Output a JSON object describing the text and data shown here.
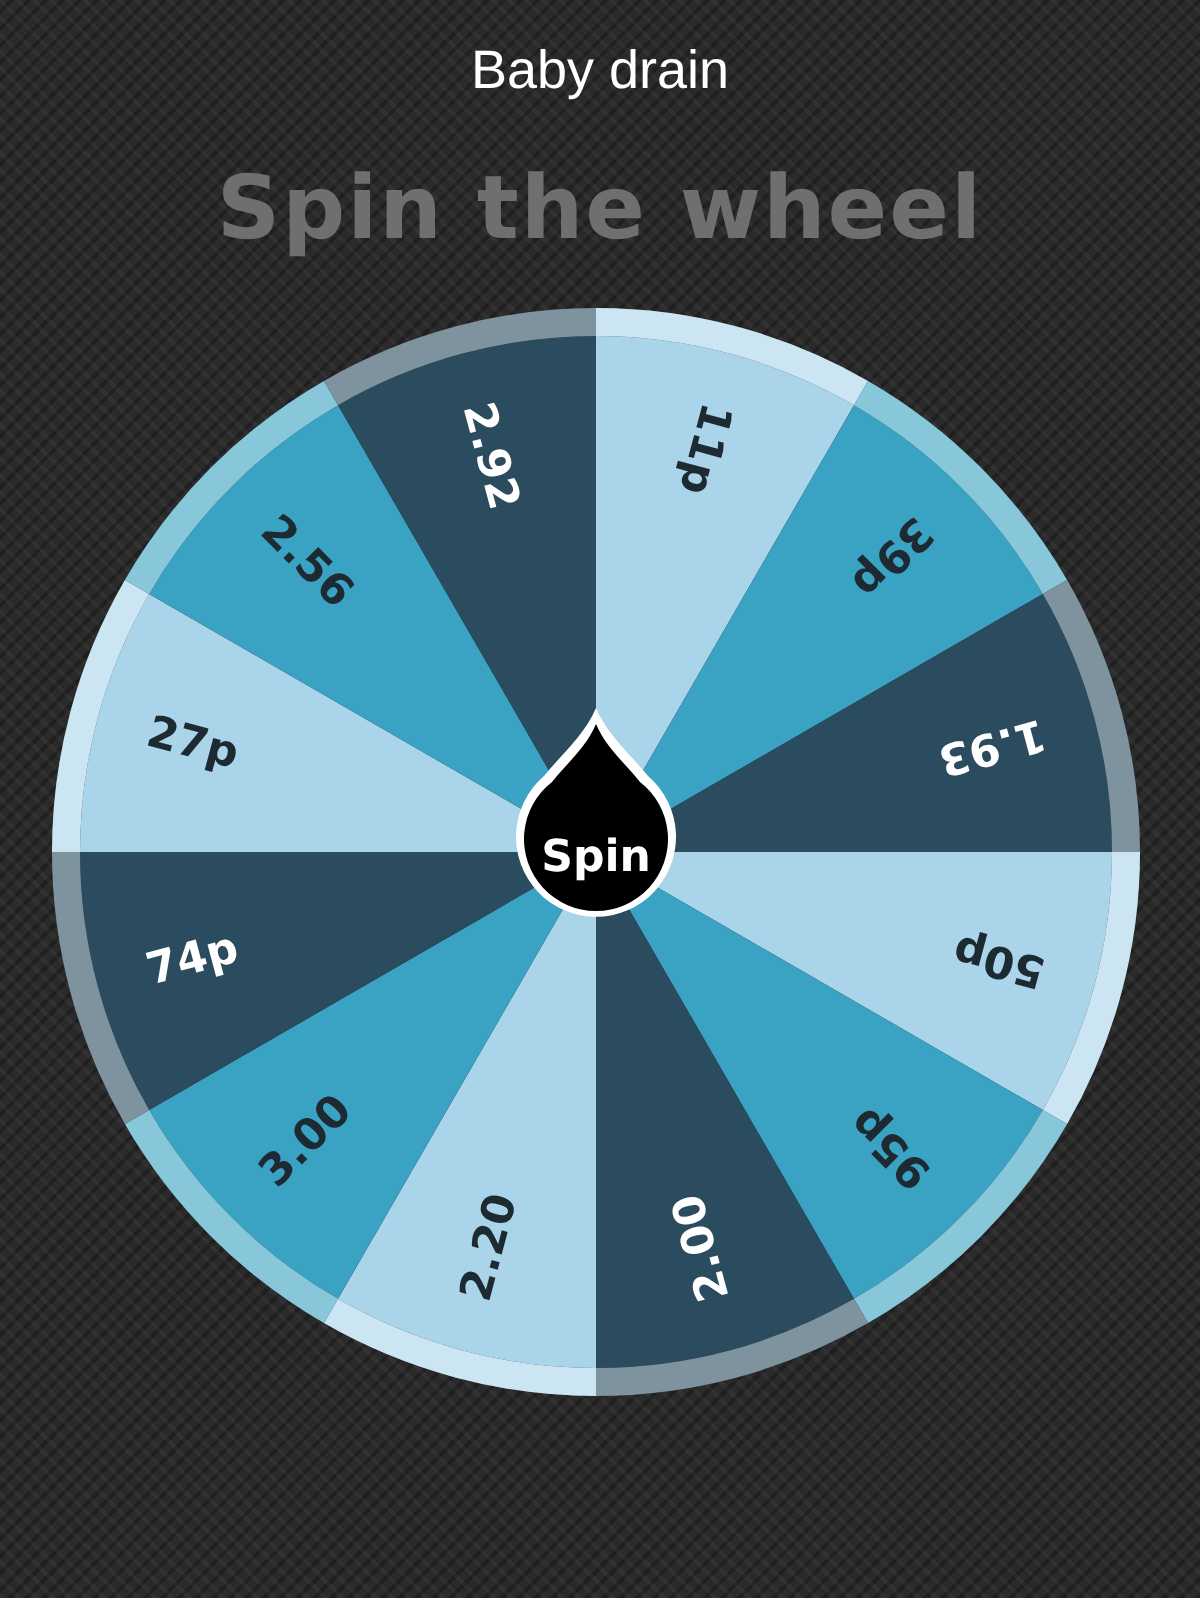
{
  "header": {
    "title": "Baby drain"
  },
  "heading": "Spin the wheel",
  "wheel": {
    "segments": [
      {
        "label": "11p",
        "color": "#a9d4e9"
      },
      {
        "label": "39p",
        "color": "#3aa2c2"
      },
      {
        "label": "1.93",
        "color": "#2b4b5f"
      },
      {
        "label": "50p",
        "color": "#a9d4e9"
      },
      {
        "label": "95p",
        "color": "#3aa2c2"
      },
      {
        "label": "2.00",
        "color": "#2b4b5f"
      },
      {
        "label": "2.20",
        "color": "#a9d4e9"
      },
      {
        "label": "3.00",
        "color": "#3aa2c2"
      },
      {
        "label": "74p",
        "color": "#2b4b5f"
      },
      {
        "label": "27p",
        "color": "#a9d4e9"
      },
      {
        "label": "2.56",
        "color": "#3aa2c2"
      },
      {
        "label": "2.92",
        "color": "#2b4b5f"
      }
    ]
  },
  "spin_button": {
    "label": "Spin"
  }
}
